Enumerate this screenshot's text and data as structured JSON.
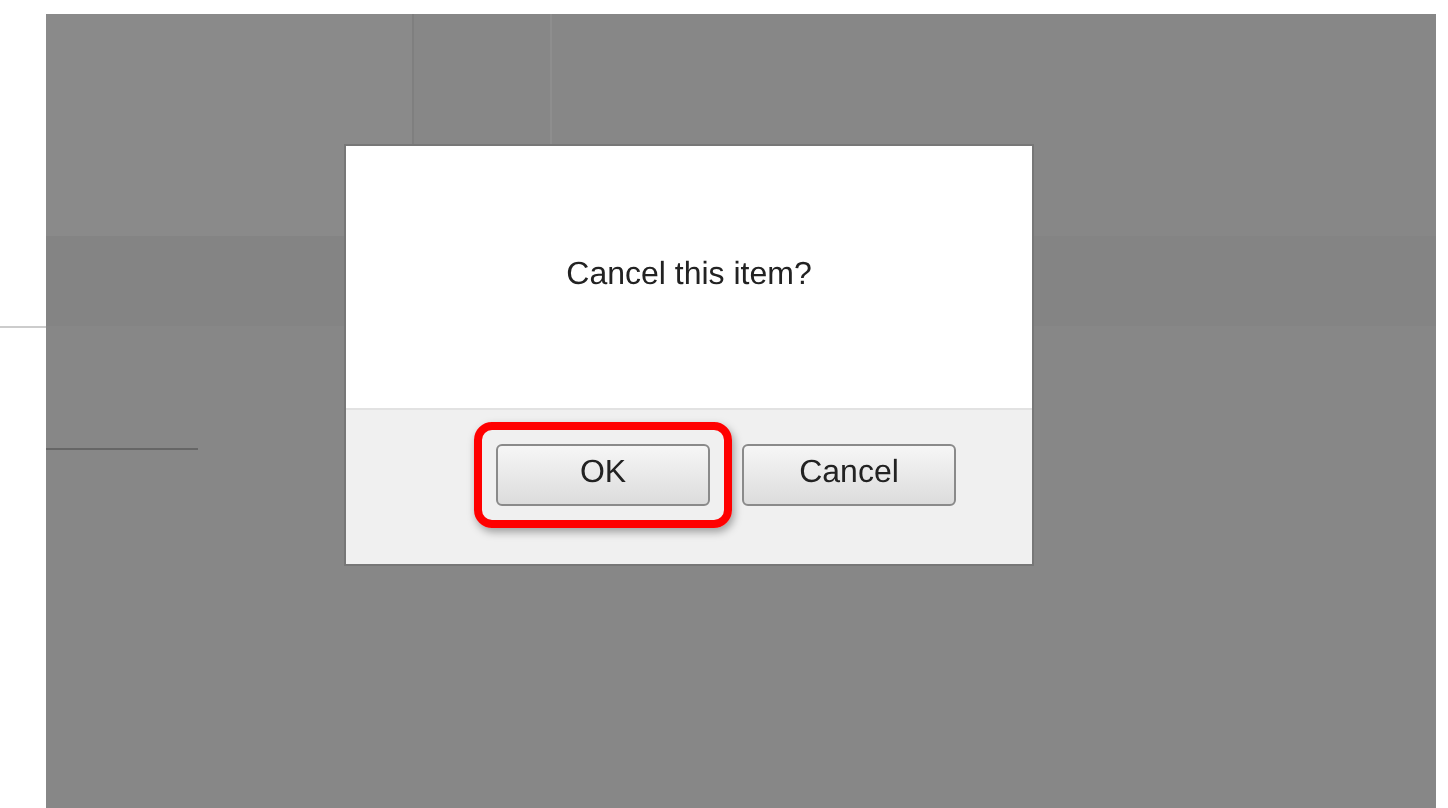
{
  "dialog": {
    "message": "Cancel this item?",
    "buttons": [
      {
        "label": "OK",
        "highlighted": true
      },
      {
        "label": "Cancel",
        "highlighted": false
      }
    ]
  }
}
